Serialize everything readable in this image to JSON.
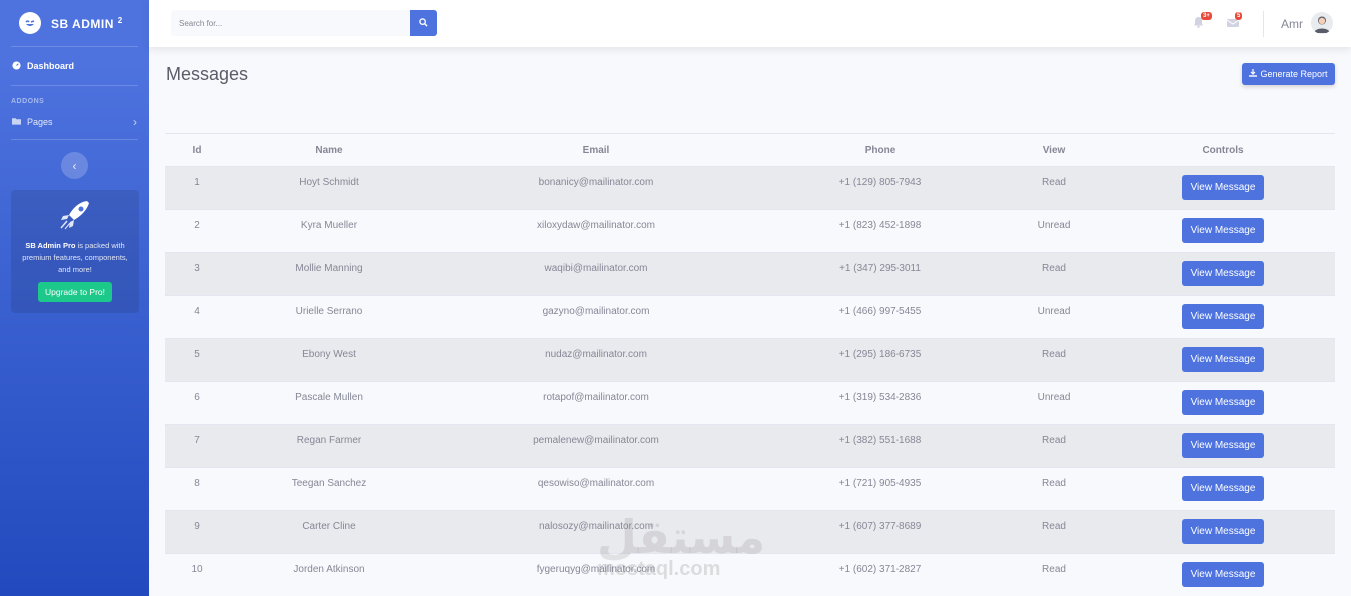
{
  "sidebar": {
    "brand": "SB ADMIN",
    "brand_sup": "2",
    "dashboard": "Dashboard",
    "addons_heading": "ADDONS",
    "pages": "Pages",
    "promo_bold": "SB Admin Pro",
    "promo_text": " is packed with premium features, components, and more!",
    "upgrade": "Upgrade to Pro!"
  },
  "topbar": {
    "search_placeholder": "Search for...",
    "alerts_badge": "3+",
    "messages_badge": "5",
    "user": "Amr"
  },
  "main": {
    "title": "Messages",
    "generate_report": "Generate Report",
    "columns": [
      "Id",
      "Name",
      "Email",
      "Phone",
      "View",
      "Controls"
    ],
    "view_button": "View Message",
    "rows": [
      {
        "id": "1",
        "name": "Hoyt Schmidt",
        "email": "bonanicy@mailinator.com",
        "phone": "+1 (129) 805-7943",
        "view": "Read"
      },
      {
        "id": "2",
        "name": "Kyra Mueller",
        "email": "xiloxydaw@mailinator.com",
        "phone": "+1 (823) 452-1898",
        "view": "Unread"
      },
      {
        "id": "3",
        "name": "Mollie Manning",
        "email": "waqibi@mailinator.com",
        "phone": "+1 (347) 295-3011",
        "view": "Read"
      },
      {
        "id": "4",
        "name": "Urielle Serrano",
        "email": "gazyno@mailinator.com",
        "phone": "+1 (466) 997-5455",
        "view": "Unread"
      },
      {
        "id": "5",
        "name": "Ebony West",
        "email": "nudaz@mailinator.com",
        "phone": "+1 (295) 186-6735",
        "view": "Read"
      },
      {
        "id": "6",
        "name": "Pascale Mullen",
        "email": "rotapof@mailinator.com",
        "phone": "+1 (319) 534-2836",
        "view": "Unread"
      },
      {
        "id": "7",
        "name": "Regan Farmer",
        "email": "pemalenew@mailinator.com",
        "phone": "+1 (382) 551-1688",
        "view": "Read"
      },
      {
        "id": "8",
        "name": "Teegan Sanchez",
        "email": "qesowiso@mailinator.com",
        "phone": "+1 (721) 905-4935",
        "view": "Read"
      },
      {
        "id": "9",
        "name": "Carter Cline",
        "email": "nalosozy@mailinator.com",
        "phone": "+1 (607) 377-8689",
        "view": "Read"
      },
      {
        "id": "10",
        "name": "Jorden Atkinson",
        "email": "fygeruqyg@mailinator.com",
        "phone": "+1 (602) 371-2827",
        "view": "Read"
      }
    ]
  },
  "watermark": {
    "arabic": "مستقل",
    "latin": "mostaql.com"
  },
  "colors": {
    "primary": "#4e73df",
    "success": "#1cc88a",
    "danger": "#e74a3b",
    "text": "#858796"
  }
}
